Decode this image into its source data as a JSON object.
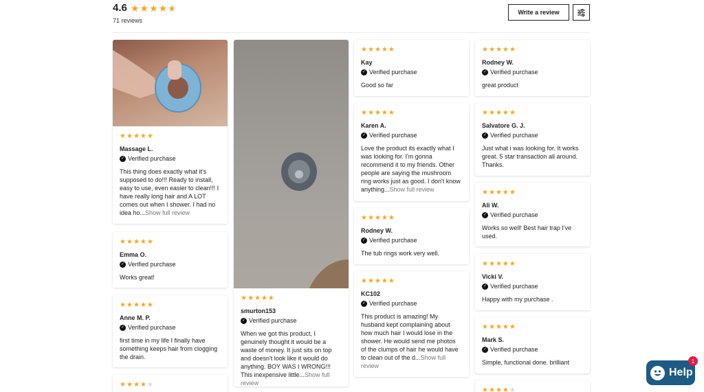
{
  "summary": {
    "rating": "4.6",
    "stars": 4.6,
    "count_text": "71 reviews"
  },
  "actions": {
    "write_review": "Write a review",
    "filter_icon": "sliders-icon"
  },
  "common": {
    "verified": "Verified purchase",
    "more": "Show full review"
  },
  "colors": {
    "star": "#f5a623",
    "star_empty": "#d9d9d9",
    "help_bg": "#1c5b84",
    "badge_bg": "#e11d48"
  },
  "col1": [
    {
      "stars": 5,
      "name": "Massage L.",
      "text": "This thing does exactly what it's supposed to do!!! Ready to install, easy to use, even easier to clean!!! I have really long hair and A LOT comes out when I shower. I had no idea ho...",
      "more": true
    },
    {
      "stars": 5,
      "name": "Emma O.",
      "text": "Works great!"
    },
    {
      "stars": 5,
      "name": "Anne M. P.",
      "text": "first time in my life I finally have something keeps hair from clogging the drain."
    },
    {
      "stars": 4
    }
  ],
  "col2": [
    {
      "stars": 5,
      "name": "smurton153",
      "text": "When we got this product, I genuinely thought it would be a waste of money. It just sits on top and doesn't look like it would do anything. BOY WAS I WRONG!!! This inexpensive little...",
      "more": true
    }
  ],
  "col3": [
    {
      "stars": 5,
      "name": "Kay",
      "text": "Good so far"
    },
    {
      "stars": 5,
      "name": "Karen A.",
      "text": "Love the product its exactly what I was looking for. I'm gonna recommend it to my friends. Other people are saying the mushroom ring works just as good. I don't know anything...",
      "more": true
    },
    {
      "stars": 5,
      "name": "Rodney W.",
      "text": "The tub rings work very well."
    },
    {
      "stars": 5,
      "name": "KC102",
      "text": "This product is amazing! My husband kept complaining about how much hair I would lose in the shower. He would send me photos of the clumps of hair he would have to clean out of the d...",
      "more": true
    }
  ],
  "col4": [
    {
      "stars": 5,
      "name": "Rodney W.",
      "text": "great product"
    },
    {
      "stars": 5,
      "name": "Salvatore G. J.",
      "text": "Just what i was looking for. It works great. 5 star transaction all around. Thanks."
    },
    {
      "stars": 5,
      "name": "Ali W.",
      "text": "Works so well! Best hair trap I've used."
    },
    {
      "stars": 5,
      "name": "Vicki V.",
      "text": "Happy with my purchase ."
    },
    {
      "stars": 5,
      "name": "Mark S.",
      "text": "Simple, functional done. brilliant"
    },
    {
      "stars": 4
    }
  ],
  "help": {
    "label": "Help",
    "badge": "1"
  }
}
